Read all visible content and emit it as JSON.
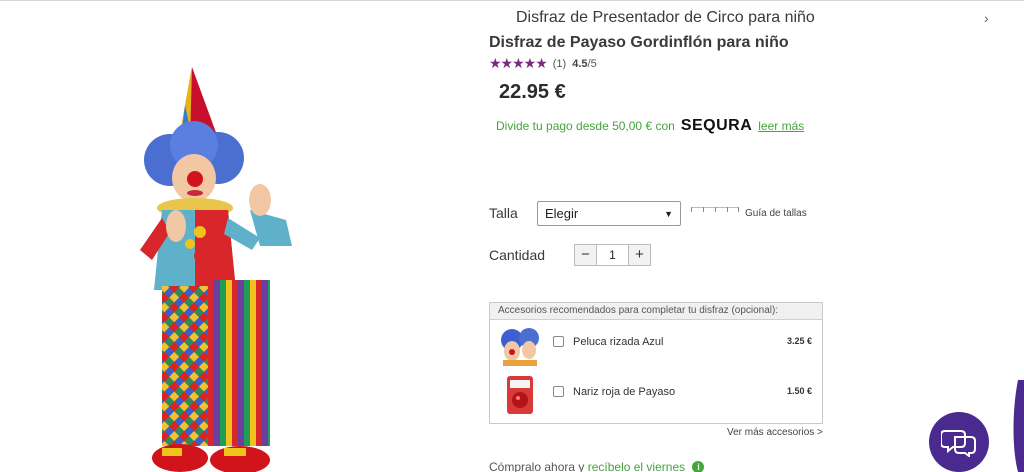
{
  "header": {
    "nav_title": "Disfraz de Presentador de Circo para niño",
    "nav_arrow": "›"
  },
  "product": {
    "title": "Disfraz de Payaso Gordinflón para niño",
    "rating": {
      "stars": "★★★★★",
      "value": 4.5,
      "count": "(1)",
      "score": "4.5",
      "score_max": "/5"
    },
    "price": "22.95 €",
    "finance": {
      "text": "Divide tu pago desde 50,00 € con",
      "brand": "SEQURA",
      "link": "leer más"
    }
  },
  "options": {
    "size_label": "Talla",
    "size_value": "Elegir",
    "size_caret": "▼",
    "size_guide": "Guía de tallas",
    "qty_label": "Cantidad",
    "qty_minus": "−",
    "qty_value": "1",
    "qty_plus": "+"
  },
  "accessories": {
    "header": "Accesorios recomendados para completar tu disfraz (opcional):",
    "items": [
      {
        "name": "Peluca rizada Azul",
        "price": "3.25 €",
        "thumb": "blue-wig"
      },
      {
        "name": "Nariz roja de Payaso",
        "price": "1.50 €",
        "thumb": "red-nose"
      }
    ],
    "more": "Ver más accesorios >"
  },
  "delivery": {
    "prefix": "Cómpralo ahora y",
    "highlight": "recíbelo el viernes",
    "info": "i"
  },
  "colors": {
    "accent": "#44a53a",
    "star": "#7a2a82",
    "chat": "#4b2a8f"
  }
}
